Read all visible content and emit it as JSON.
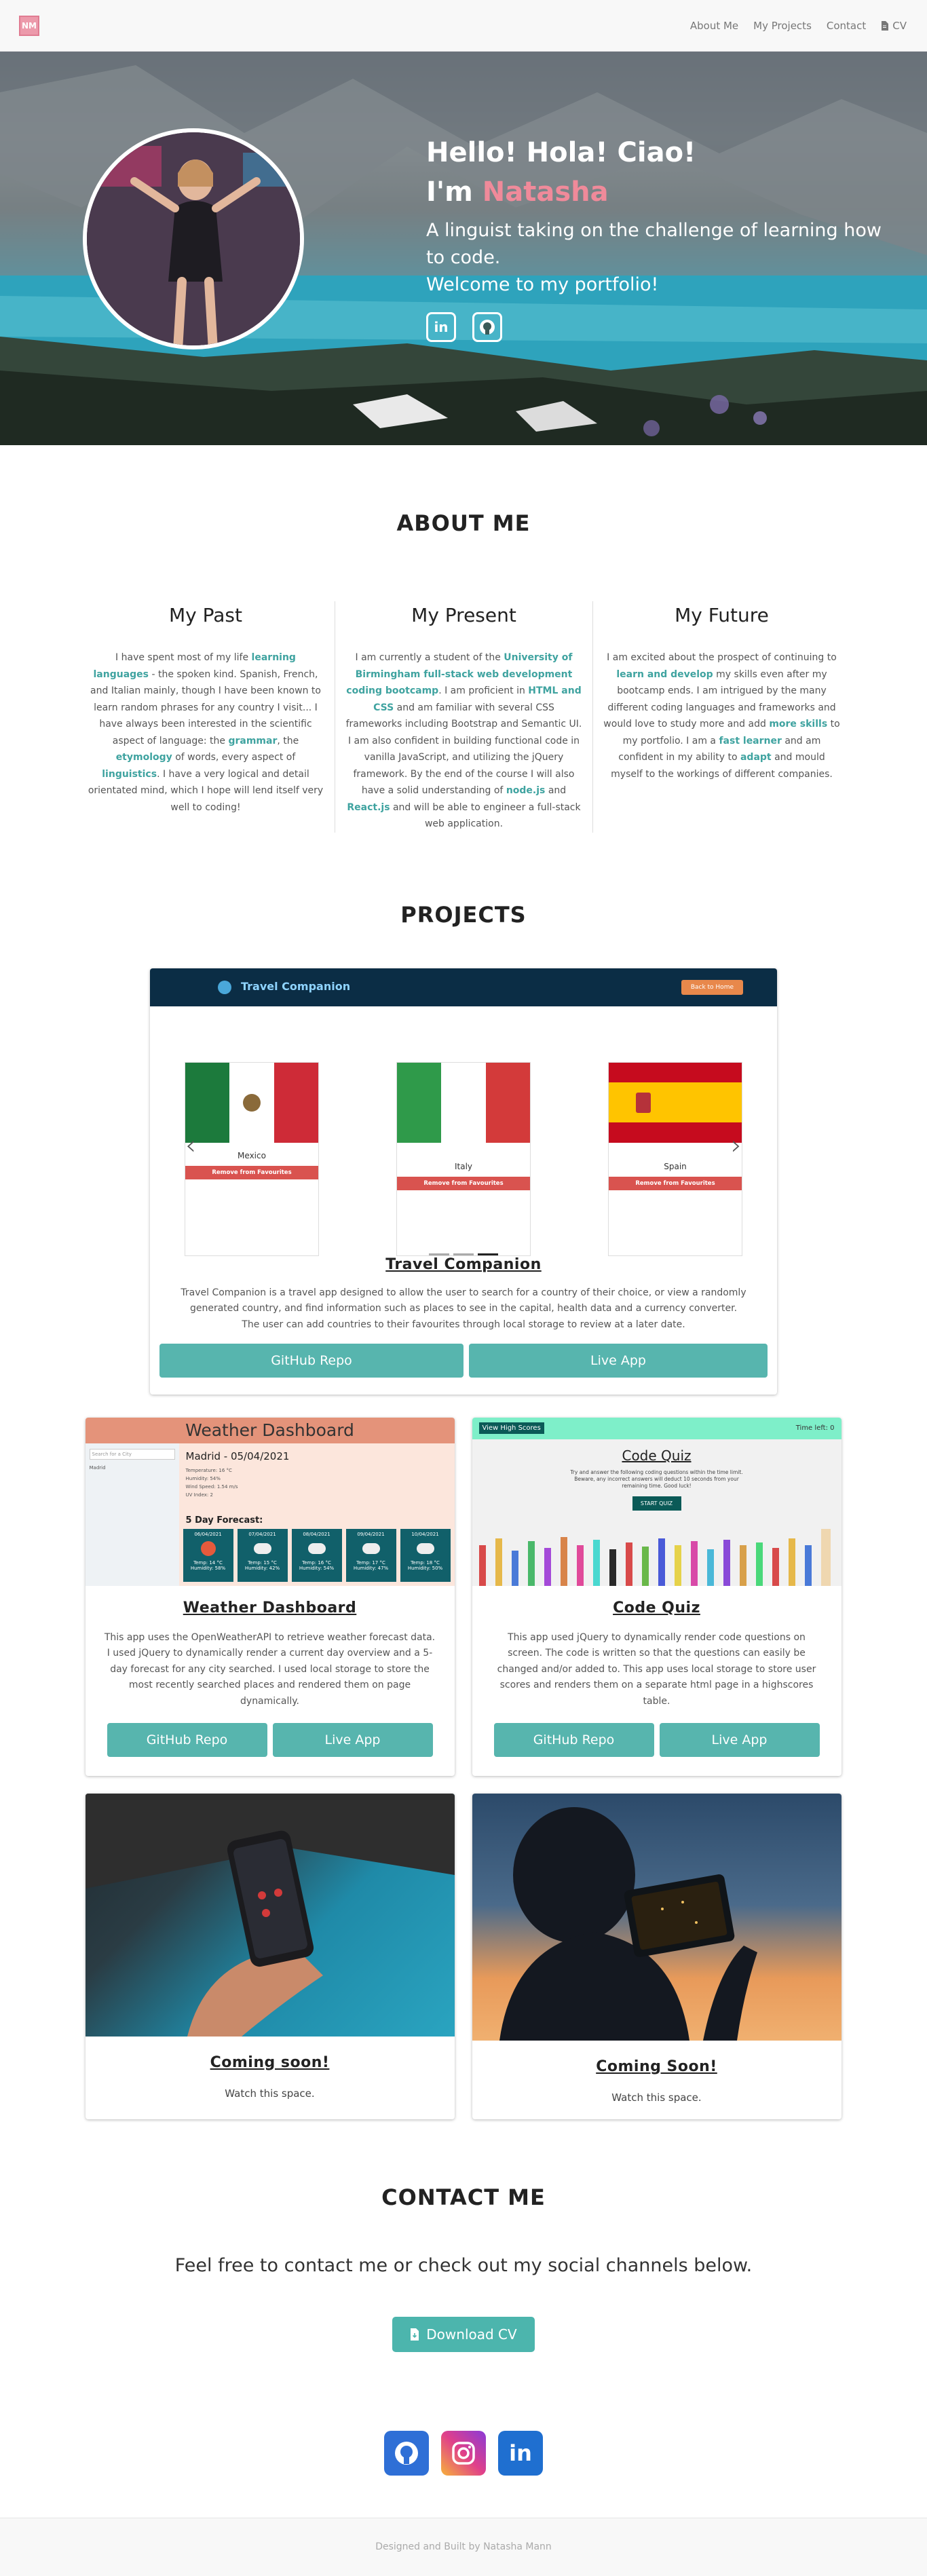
{
  "nav": {
    "logo": "NM",
    "links": [
      "About Me",
      "My Projects",
      "Contact",
      "CV"
    ]
  },
  "hero": {
    "greeting": "Hello! Hola! Ciao!",
    "im": "I'm",
    "name": "Natasha",
    "tagline": "A linguist taking on the challenge of learning how to code.",
    "welcome": "Welcome to my portfolio!",
    "socials": [
      "linkedin-icon",
      "github-icon"
    ]
  },
  "about": {
    "title": "ABOUT ME",
    "past": {
      "heading": "My Past",
      "p1": "I have spent most of my life ",
      "h1": "learning languages",
      "p2": " - the spoken kind. Spanish, French, and Italian mainly, though I have been known to learn random phrases for any country I visit... I have always been interested in the scientific aspect of language: the ",
      "h2": "grammar",
      "p3": ", the ",
      "h3": "etymology",
      "p4": " of words, every aspect of ",
      "h4": "linguistics",
      "p5": ". I have a very logical and detail orientated mind, which I hope will lend itself very well to coding!"
    },
    "present": {
      "heading": "My Present",
      "p1": "I am currently a student of the ",
      "h1": "University of Birmingham full-stack web development coding bootcamp",
      "p2": ". I am proficient in ",
      "h2": "HTML and CSS",
      "p3": " and am familiar with several CSS frameworks including Bootstrap and Semantic UI. I am also confident in building functional code in vanilla JavaScript, and utilizing the jQuery framework. By the end of the course I will also have a solid understanding of ",
      "h3": "node.js",
      "p4": " and ",
      "h4": "React.js",
      "p5": " and will be able to engineer a full-stack web application."
    },
    "future": {
      "heading": "My Future",
      "p1": "I am excited about the prospect of continuing to ",
      "h1": "learn and develop",
      "p2": " my skills even after my bootcamp ends. I am intrigued by the many different coding languages and frameworks and would love to study more and add ",
      "h2": "more skills",
      "p3": " to my portfolio. I am a ",
      "h3": "fast learner",
      "p4": " and am confident in my ability to ",
      "h4": "adapt",
      "p5": " and mould myself to the workings of different companies."
    }
  },
  "projects": {
    "title": "PROJECTS",
    "featured": {
      "app_title": "Travel Companion",
      "app_button": "Back to Home",
      "countries": [
        {
          "name": "Mexico",
          "colors": [
            "#1c7a3c",
            "#ffffff",
            "#ce2b37"
          ],
          "button": "Remove from Favourites"
        },
        {
          "name": "Italy",
          "colors": [
            "#2f9a4a",
            "#ffffff",
            "#d33a3a"
          ],
          "button": "Remove from Favourites"
        },
        {
          "name": "Spain",
          "colors": [
            "#c60b1e",
            "#ffc400",
            "#c60b1e"
          ],
          "button": "Remove from Favourites"
        }
      ],
      "title": "Travel Companion",
      "description": "Travel Companion is a travel app designed to allow the user to search for a country of their choice, or view a randomly generated country, and find information such as places to see in the capital, health data and a currency converter. The user can add countries to their favourites through local storage to review at a later date.",
      "repo": "GitHub Repo",
      "live": "Live App"
    },
    "weather": {
      "shot_header": "Weather Dashboard",
      "search_placeholder": "Search for a City",
      "history_item": "Madrid",
      "city_date": "Madrid - 05/04/2021",
      "current_lines": [
        "Temperature: 16 °C",
        "Humidity: 54%",
        "Wind Speed: 1.54 m/s",
        "UV Index: 2"
      ],
      "forecast_title": "5 Day Forecast:",
      "forecast": [
        {
          "date": "06/04/2021",
          "temp": "Temp: 14 °C",
          "hum": "Humidity: 58%"
        },
        {
          "date": "07/04/2021",
          "temp": "Temp: 15 °C",
          "hum": "Humidity: 42%"
        },
        {
          "date": "08/04/2021",
          "temp": "Temp: 16 °C",
          "hum": "Humidity: 54%"
        },
        {
          "date": "09/04/2021",
          "temp": "Temp: 17 °C",
          "hum": "Humidity: 47%"
        },
        {
          "date": "10/04/2021",
          "temp": "Temp: 18 °C",
          "hum": "Humidity: 50%"
        }
      ],
      "title": "Weather Dashboard",
      "description": "This app uses the OpenWeatherAPI to retrieve weather forecast data. I used jQuery to dynamically render a current day overview and a 5-day forecast for any city searched. I used local storage to store the most recently searched places and rendered them on page dynamically.",
      "repo": "GitHub Repo",
      "live": "Live App"
    },
    "quiz": {
      "shot_view": "View High Scores",
      "shot_time": "Time left: 0",
      "shot_title": "Code Quiz",
      "shot_text": "Try and answer the following coding questions within the time limit. Beware, any incorrect answers will deduct 10 seconds from your remaining time. Good luck!",
      "shot_button": "START QUIZ",
      "title": "Code Quiz",
      "description": "This app used jQuery to dynamically render code questions on screen. The code is written so that the questions can easily be changed and/or added to. This app uses local storage to store user scores and renders them on a separate html page in a highscores table.",
      "repo": "GitHub Repo",
      "live": "Live App"
    },
    "soon1": {
      "title": "Coming soon!",
      "text": "Watch this space."
    },
    "soon2": {
      "title": "Coming Soon!",
      "text": "Watch this space."
    }
  },
  "contact": {
    "title": "CONTACT ME",
    "text": "Feel free to contact me or check out my social channels below.",
    "cv_button": "Download CV",
    "icons": [
      "github-icon",
      "instagram-icon",
      "linkedin-icon"
    ]
  },
  "footer": {
    "text": "Designed and Built by Natasha Mann"
  }
}
